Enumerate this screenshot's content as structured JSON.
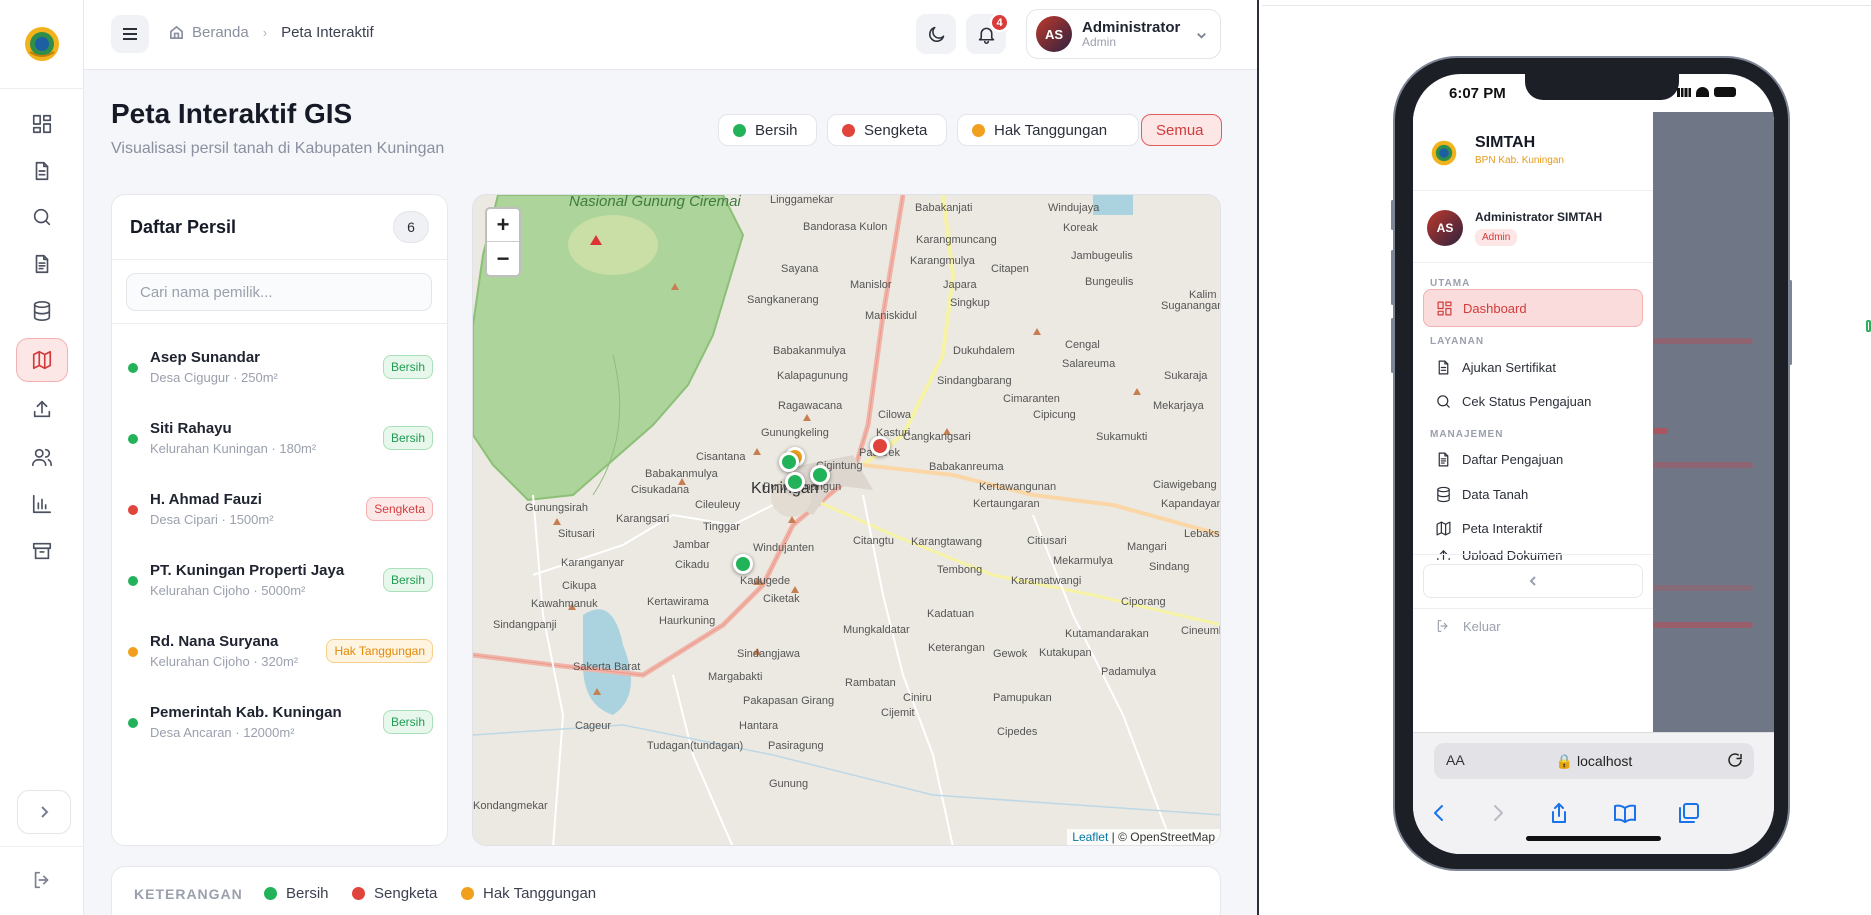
{
  "header": {
    "breadcrumb_home": "Beranda",
    "breadcrumb_current": "Peta Interaktif",
    "notification_count": "4",
    "user_initials": "AS",
    "user_name": "Administrator",
    "user_role": "Admin"
  },
  "page": {
    "title": "Peta Interaktif GIS",
    "subtitle": "Visualisasi persil tanah di Kabupaten Kuningan"
  },
  "filters": [
    {
      "label": "Bersih",
      "color": "#22b35a"
    },
    {
      "label": "Sengketa",
      "color": "#e0443b"
    },
    {
      "label": "Hak Tanggungan",
      "color": "#f0a01c"
    },
    {
      "label": "Semua",
      "active": true
    }
  ],
  "list": {
    "title": "Daftar Persil",
    "count": "6",
    "search_placeholder": "Cari nama pemilik...",
    "items": [
      {
        "name": "Asep Sunandar",
        "detail": "Desa Cigugur · 250m²",
        "status": "Bersih"
      },
      {
        "name": "Siti Rahayu",
        "detail": "Kelurahan Kuningan · 180m²",
        "status": "Bersih"
      },
      {
        "name": "H. Ahmad Fauzi",
        "detail": "Desa Cipari · 1500m²",
        "status": "Sengketa"
      },
      {
        "name": "PT. Kuningan Properti Jaya",
        "detail": "Kelurahan Cijoho · 5000m²",
        "status": "Bersih"
      },
      {
        "name": "Rd. Nana Suryana",
        "detail": "Kelurahan Cijoho · 320m²",
        "status": "Hak Tanggungan"
      },
      {
        "name": "Pemerintah Kab. Kuningan",
        "detail": "Desa Ancaran · 12000m²",
        "status": "Bersih"
      }
    ]
  },
  "map": {
    "zoom_in": "+",
    "zoom_out": "−",
    "attribution_leaflet": "Leaflet",
    "attribution_rest": "| © OpenStreetMap",
    "park_label": "Nasional Gunung Ciremai",
    "city_label": "Kuningan",
    "place_labels": [
      "Linggamekar",
      "Babakanjati",
      "Windujaya",
      "Bandorasa Kulon",
      "Koreak",
      "Karangmuncang",
      "Sayana",
      "Karangmulya",
      "Citapen",
      "Jambugeulis",
      "Manislor",
      "Japara",
      "Sangkanerang",
      "Bungeulis",
      "Kalim",
      "Maniskidul",
      "Singkup",
      "Suganangan",
      "Babakanmulya",
      "Dukuhdalem",
      "Cengal",
      "Kalapagunung",
      "Salareuma",
      "Sindangbarang",
      "Sukaraja",
      "Ragawacana",
      "Cimaranten",
      "Cilowa",
      "Cipicung",
      "Mekarjaya",
      "Gunungkeling",
      "Kasturi",
      "Cangkangsari",
      "Sukamukti",
      "Padarek",
      "Cisantana",
      "Babakanreuma",
      "Babakanmulya",
      "Cigintung",
      "Cisukadana",
      "Ciawigebang",
      "Purwawinangun",
      "Kertawangunan",
      "Gunungsirah",
      "Cileuleuy",
      "Kertaungaran",
      "Kapandayan",
      "Karangsari",
      "Tinggar",
      "Situsari",
      "Citangtu",
      "Citiusari",
      "Karangtawang",
      "Windujanten",
      "Jambar",
      "Mekarmulya",
      "Lebaksiu",
      "Karanganyar",
      "Mangari",
      "Cikadu",
      "Tembong",
      "Sindang",
      "Kadugede",
      "Karamatwangi",
      "Cikupa",
      "Ciketak",
      "Kertawirama",
      "Ciporang",
      "Kawahmanuk",
      "Haurkuning",
      "Kadatuan",
      "Sindangpanji",
      "Mungkaldatar",
      "Kutamandarakan",
      "Cineumbeuy",
      "Keterangan",
      "Sindangjawa",
      "Gewok",
      "Kutakupan",
      "Sakerta Barat",
      "Rambatan",
      "Ciniru",
      "Padamulya",
      "Margabakti",
      "Pamupukan",
      "Pakapasan Girang",
      "Cijemit",
      "Cageur",
      "Hantara",
      "Cipedes",
      "Tudagan(tundagan)",
      "Pasiragung",
      "Kondangmekar",
      "Gunung"
    ],
    "markers": [
      {
        "status": "Bersih"
      },
      {
        "status": "Bersih"
      },
      {
        "status": "Sengketa"
      },
      {
        "status": "Bersih"
      },
      {
        "status": "Hak Tanggungan"
      },
      {
        "status": "Bersih"
      }
    ]
  },
  "legend": {
    "title": "KETERANGAN",
    "items": [
      {
        "label": "Bersih",
        "color": "#22b35a"
      },
      {
        "label": "Sengketa",
        "color": "#e0443b"
      },
      {
        "label": "Hak Tanggungan",
        "color": "#f0a01c"
      }
    ]
  },
  "phone": {
    "time": "6:07 PM",
    "app_name": "SIMTAH",
    "app_sub": "BPN Kab. Kuningan",
    "user_initials": "AS",
    "user_name": "Administrator SIMTAH",
    "user_role": "Admin",
    "sections": [
      "UTAMA",
      "LAYANAN",
      "MANAJEMEN"
    ],
    "menu": [
      {
        "label": "Dashboard",
        "icon": "dashboard-icon",
        "active": true
      },
      {
        "label": "Ajukan Sertifikat",
        "icon": "document-icon"
      },
      {
        "label": "Cek Status Pengajuan",
        "icon": "search-icon"
      },
      {
        "label": "Daftar Pengajuan",
        "icon": "document-list-icon"
      },
      {
        "label": "Data Tanah",
        "icon": "database-icon"
      },
      {
        "label": "Peta Interaktif",
        "icon": "map-icon"
      },
      {
        "label": "Upload Dokumen",
        "icon": "upload-icon"
      }
    ],
    "logout": "Keluar",
    "url_aa": "AA",
    "url": "localhost"
  },
  "colors": {
    "accent": "#d23b3b",
    "bersih": "#22b35a",
    "sengketa": "#e0443b",
    "hak_tanggungan": "#f0a01c"
  }
}
